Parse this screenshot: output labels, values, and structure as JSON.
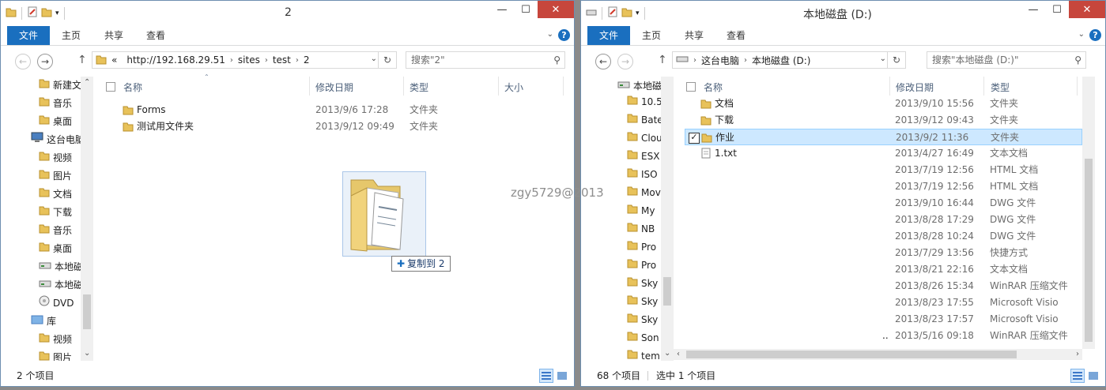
{
  "watermark": "zgy5729@2013",
  "left_window": {
    "title": "2",
    "ribbon_tabs": [
      "文件",
      "主页",
      "共享",
      "查看"
    ],
    "help": "?",
    "address": {
      "overflow": "«",
      "segments": [
        "http://192.168.29.51",
        "sites",
        "test",
        "2"
      ]
    },
    "search_placeholder": "搜索\"2\"",
    "nav_tree": [
      {
        "label": "新建文",
        "icon": "folder-icon"
      },
      {
        "label": "音乐",
        "icon": "folder-icon"
      },
      {
        "label": "桌面",
        "icon": "folder-icon"
      },
      {
        "label": "这台电脑",
        "icon": "computer-icon"
      },
      {
        "label": "视频",
        "icon": "folder-icon"
      },
      {
        "label": "图片",
        "icon": "folder-icon"
      },
      {
        "label": "文档",
        "icon": "folder-icon"
      },
      {
        "label": "下载",
        "icon": "folder-icon"
      },
      {
        "label": "音乐",
        "icon": "folder-icon"
      },
      {
        "label": "桌面",
        "icon": "folder-icon"
      },
      {
        "label": "本地磁",
        "icon": "drive-icon"
      },
      {
        "label": "本地磁",
        "icon": "drive-icon"
      },
      {
        "label": "DVD",
        "icon": "dvd-icon"
      },
      {
        "label": "库",
        "icon": "library-icon"
      },
      {
        "label": "视频",
        "icon": "folder-icon"
      },
      {
        "label": "图片",
        "icon": "folder-icon"
      }
    ],
    "columns": [
      "名称",
      "修改日期",
      "类型",
      "大小"
    ],
    "files": [
      {
        "name": "Forms",
        "date": "2013/9/6 17:28",
        "type": "文件夹"
      },
      {
        "name": "测试用文件夹",
        "date": "2013/9/12 09:49",
        "type": "文件夹"
      }
    ],
    "status": "2 个项目",
    "drop_tip": "复制到 2"
  },
  "right_window": {
    "title": "本地磁盘 (D:)",
    "ribbon_tabs": [
      "文件",
      "主页",
      "共享",
      "查看"
    ],
    "help": "?",
    "address": {
      "segments": [
        "这台电脑",
        "本地磁盘 (D:)"
      ]
    },
    "search_placeholder": "搜索\"本地磁盘 (D:)\"",
    "nav_tree": [
      "本地磁",
      "10.5",
      "Bate",
      "Clou",
      "ESX",
      "ISO",
      "Mov",
      "My",
      "NB",
      "Pro",
      "Pro",
      "Sky",
      "Sky",
      "Sky",
      "Son",
      "tem"
    ],
    "columns": [
      "名称",
      "修改日期",
      "类型"
    ],
    "files": [
      {
        "name": "文档",
        "date": "2013/9/10 15:56",
        "type": "文件夹",
        "icon": "folder"
      },
      {
        "name": "下载",
        "date": "2013/9/12 09:43",
        "type": "文件夹",
        "icon": "folder"
      },
      {
        "name": "作业",
        "date": "2013/9/2 11:36",
        "type": "文件夹",
        "icon": "folder",
        "selected": true
      },
      {
        "name": "1.txt",
        "date": "2013/4/27 16:49",
        "type": "文本文档",
        "icon": "txt"
      },
      {
        "name": "",
        "date": "2013/7/19 12:56",
        "type": "HTML 文档"
      },
      {
        "name": "",
        "date": "2013/7/19 12:56",
        "type": "HTML 文档"
      },
      {
        "name": "",
        "date": "2013/9/10 16:44",
        "type": "DWG 文件"
      },
      {
        "name": "",
        "date": "2013/8/28 17:29",
        "type": "DWG 文件"
      },
      {
        "name": "",
        "date": "2013/8/28 10:24",
        "type": "DWG 文件"
      },
      {
        "name": "",
        "date": "2013/7/29 13:56",
        "type": "快捷方式"
      },
      {
        "name": "",
        "date": "2013/8/21 22:16",
        "type": "文本文档"
      },
      {
        "name": "",
        "date": "2013/8/26 15:34",
        "type": "WinRAR 压缩文件"
      },
      {
        "name": "",
        "date": "2013/8/23 17:55",
        "type": "Microsoft Visio"
      },
      {
        "name": "",
        "date": "2013/8/23 17:57",
        "type": "Microsoft Visio"
      },
      {
        "name": "..",
        "date": "2013/5/16 09:18",
        "type": "WinRAR 压缩文件"
      }
    ],
    "status_count": "68 个项目",
    "status_selected": "选中 1 个项目"
  }
}
